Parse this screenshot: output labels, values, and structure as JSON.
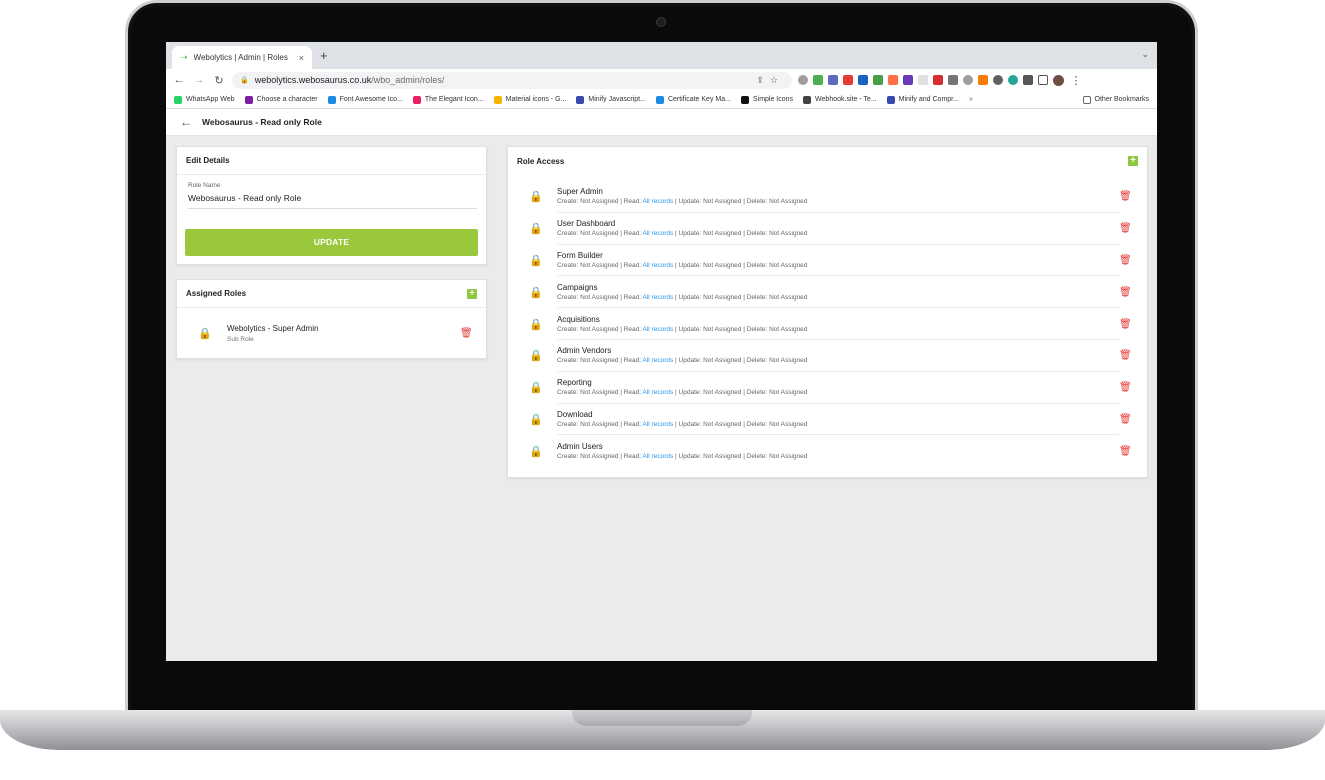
{
  "browser": {
    "tab_title": "Webolytics | Admin | Roles",
    "tab_close": "×",
    "new_tab": "+",
    "tab_menu": "⌄",
    "url_host": "webolytics.webosaurus.co.uk",
    "url_path": "/wbo_admin/roles/",
    "bookmarks": [
      {
        "label": "WhatsApp Web",
        "color": "#25d366"
      },
      {
        "label": "Choose a character",
        "color": "#7b1fa2"
      },
      {
        "label": "Font Awesome Ico...",
        "color": "#1e88e5"
      },
      {
        "label": "The Elegant Icon...",
        "color": "#e91e63"
      },
      {
        "label": "Material icons - G...",
        "color": "#f4b400"
      },
      {
        "label": "Minify Javascript...",
        "color": "#3949ab"
      },
      {
        "label": "Certificate Key Ma...",
        "color": "#1e88e5"
      },
      {
        "label": "Simple Icons",
        "color": "#111111"
      },
      {
        "label": "Webhook.site - Te...",
        "color": "#424242"
      },
      {
        "label": "Minify and Compr...",
        "color": "#3949ab"
      }
    ],
    "bookmarks_more": "»",
    "other_bookmarks": "Other Bookmarks"
  },
  "header": {
    "title": "Webosaurus - Read only Role"
  },
  "edit_details": {
    "heading": "Edit Details",
    "role_name_label": "Role Name",
    "role_name_value": "Webosaurus - Read only Role",
    "update_label": "UPDATE"
  },
  "assigned_roles": {
    "heading": "Assigned Roles",
    "items": [
      {
        "name": "Webolytics - Super Admin",
        "sub": "Sub Role"
      }
    ]
  },
  "role_access": {
    "heading": "Role Access",
    "perm_create": "Create: Not Assigned | Read: ",
    "perm_read_link": "All records",
    "perm_rest": " | Update: Not Assigned | Delete: Not Assigned",
    "items": [
      {
        "name": "Super Admin"
      },
      {
        "name": "User Dashboard"
      },
      {
        "name": "Form Builder"
      },
      {
        "name": "Campaigns"
      },
      {
        "name": "Acquisitions"
      },
      {
        "name": "Admin Vendors"
      },
      {
        "name": "Reporting"
      },
      {
        "name": "Download"
      },
      {
        "name": "Admin Users"
      }
    ]
  },
  "colors": {
    "accent_green": "#9ac73b",
    "delete_red": "#e53935",
    "link_blue": "#2196f3"
  }
}
